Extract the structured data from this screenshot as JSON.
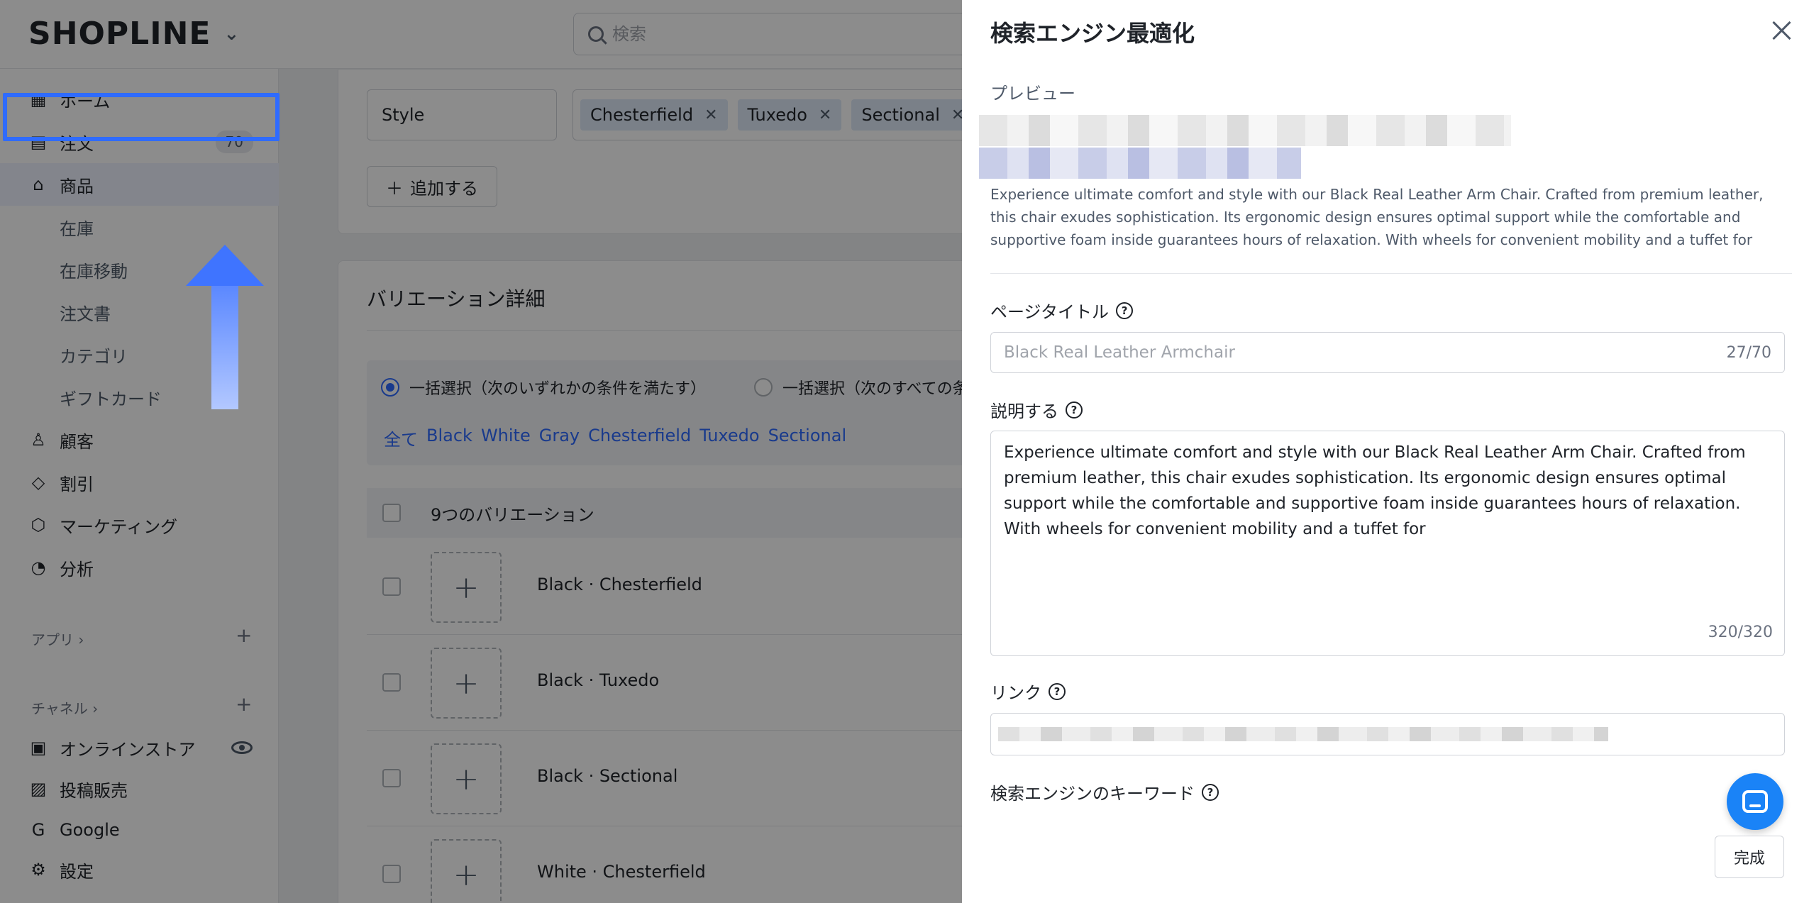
{
  "topbar": {
    "logo": "SHOPLINE",
    "search_placeholder": "検索"
  },
  "sidebar": {
    "items": [
      {
        "label": "ホーム",
        "icon": "home-icon"
      },
      {
        "label": "注文",
        "icon": "order-icon",
        "badge": "70"
      },
      {
        "label": "商品",
        "icon": "bag-icon",
        "active": true
      },
      {
        "label": "在庫"
      },
      {
        "label": "在庫移動"
      },
      {
        "label": "注文書"
      },
      {
        "label": "カテゴリ"
      },
      {
        "label": "ギフトカード"
      },
      {
        "label": "顧客",
        "icon": "customer-icon"
      },
      {
        "label": "割引",
        "icon": "tag-icon"
      },
      {
        "label": "マーケティング",
        "icon": "marketing-icon"
      },
      {
        "label": "分析",
        "icon": "analytics-icon"
      }
    ],
    "apps_label": "アプリ",
    "channels_label": "チャネル",
    "channels": [
      {
        "label": "オンラインストア",
        "icon": "store-icon"
      },
      {
        "label": "投稿販売",
        "icon": "post-icon"
      },
      {
        "label": "Google",
        "icon": "google-icon"
      }
    ],
    "settings_label": "設定",
    "highlight_color": "#2f6bff"
  },
  "main": {
    "option_name": "Style",
    "option_values": [
      "Chesterfield",
      "Tuxedo",
      "Sectional"
    ],
    "add_button": "追加する",
    "variations_title": "バリエーション詳細",
    "radio_any": "一括選択（次のいずれかの条件を満たす）",
    "radio_all": "一括選択（次のすべての条件を満",
    "filter_chips": [
      "全て",
      "Black",
      "White",
      "Gray",
      "Chesterfield",
      "Tuxedo",
      "Sectional"
    ],
    "variations_count": "9つのバリエーション",
    "variants": [
      "Black · Chesterfield",
      "Black · Tuxedo",
      "Black · Sectional",
      "White · Chesterfield"
    ]
  },
  "drawer": {
    "title": "検索エンジン最適化",
    "preview_label": "プレビュー",
    "preview_description": "Experience ultimate comfort and style with our Black Real Leather Arm Chair. Crafted from premium leather, this chair exudes sophistication. Its ergonomic design ensures optimal support while the comfortable and supportive foam inside guarantees hours of relaxation. With wheels for convenient mobility and a tuffet for",
    "page_title_label": "ページタイトル",
    "page_title_placeholder": "Black Real Leather Armchair",
    "page_title_counter": "27/70",
    "description_label": "説明する",
    "description_value": "Experience ultimate comfort and style with our Black Real Leather Arm Chair. Crafted from premium leather, this chair exudes sophistication. Its ergonomic design ensures optimal support while the comfortable and supportive foam inside guarantees hours of relaxation. With wheels for convenient mobility and a tuffet for",
    "description_counter": "320/320",
    "link_label": "リンク",
    "keywords_label": "検索エンジンのキーワード",
    "done_button": "完成"
  }
}
